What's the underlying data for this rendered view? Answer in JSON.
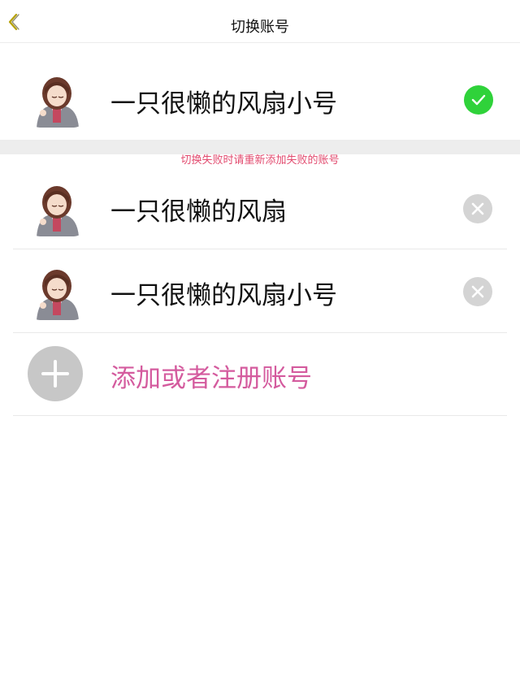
{
  "header": {
    "title": "切换账号",
    "back_icon": "chevron-left-icon"
  },
  "current_account": {
    "name": "一只很懒的风扇小号",
    "status_icon": "check-circle-icon",
    "status_color": "#2fd23a"
  },
  "hint": {
    "text": "切换失败时请重新添加失败的账号",
    "color": "#e24a6e"
  },
  "accounts": [
    {
      "name": "一只很懒的风扇",
      "action_icon": "remove-x-icon"
    },
    {
      "name": "一只很懒的风扇小号",
      "action_icon": "remove-x-icon"
    }
  ],
  "add_account": {
    "label": "添加或者注册账号",
    "icon": "plus-icon",
    "color": "#d45b9e"
  }
}
